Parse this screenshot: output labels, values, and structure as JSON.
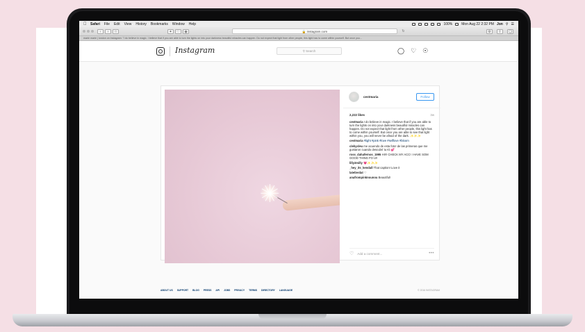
{
  "menubar": {
    "items": [
      "Safari",
      "File",
      "Edit",
      "View",
      "History",
      "Bookmarks",
      "Window",
      "Help"
    ],
    "battery": "100%",
    "clock": "Mon Aug 22  2:32 PM",
    "user": "Jon"
  },
  "browser": {
    "address": "instagram.com",
    "tab_title": "marie marie | london on Instagram: \"I do believe in magic. I believe that if you are able to turn the lights on into your darkness beautiful miracles can happen. Do not expect that light from other people, this light has to come within yourself. But once you..."
  },
  "instagram": {
    "wordmark": "Instagram",
    "search_placeholder": "Search",
    "post": {
      "username": "cestmaria",
      "follow_label": "Follow",
      "likes": "2,222 likes",
      "time": "3w",
      "caption_user": "cestmaria",
      "caption": "I do believe in magic. I believe that if you are able to turn the lights on into your darkness beautiful miracles can happen. Do not expect that light from other people, this light has to come within yourself. But once you are able to see that light within you, you will never be afraid of the dark. ✨✨✨",
      "comments": [
        {
          "user": "cestmaria",
          "text": "#light #pink #love #selflove #bloom"
        },
        {
          "user": "clebycleu",
          "text": "me acuendo de esta foto! de las primeras que me gustaron cuando descubrí tu IG 💕"
        },
        {
          "user": "ross_dahafernos_1995",
          "text": "HI!!! CHECK MY ACC! I HAVE SOM GOOD THING FO U!!"
        },
        {
          "user": "lilly2milly",
          "text": "💗✨✨✨"
        },
        {
          "user": "_hey_its_kendall",
          "text": "That caption! Love it"
        },
        {
          "user": "latelierdat",
          "text": "♡"
        },
        {
          "user": "anafrompinknounou",
          "text": "Beautiful!"
        }
      ],
      "add_comment_placeholder": "Add a comment..."
    },
    "footer": {
      "links": [
        "ABOUT US",
        "SUPPORT",
        "BLOG",
        "PRESS",
        "API",
        "JOBS",
        "PRIVACY",
        "TERMS",
        "DIRECTORY",
        "LANGUAGE"
      ],
      "copyright": "© 2016 INSTAGRAM"
    }
  },
  "colors": {
    "background": "#f5dfe5",
    "link_blue": "#3897f0",
    "hashtag_blue": "#003569"
  },
  "icons": [
    "apple-icon",
    "instagram-camera-icon",
    "compass-icon",
    "heart-icon",
    "person-icon",
    "more-icon"
  ]
}
